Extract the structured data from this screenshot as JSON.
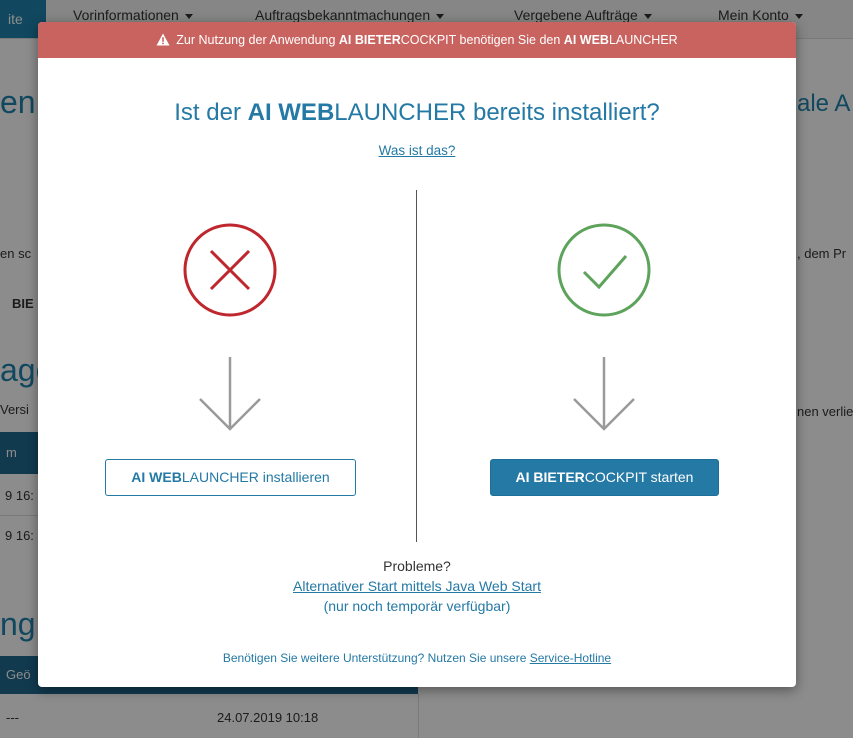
{
  "background": {
    "nav": {
      "home_label": "ite",
      "items": [
        {
          "label": "Vorinformationen"
        },
        {
          "label": "Auftragsbekanntmachungen"
        },
        {
          "label": "Vergebene Aufträge"
        },
        {
          "label": "Mein Konto"
        }
      ]
    },
    "fragments": {
      "heading_left": "en",
      "heading_right": "ale A",
      "text_left_1": "en sc",
      "text_right_1": ", dem Pr",
      "text_left_bold": "BIE",
      "heading_left_2": "age",
      "text_left_2": "Versi",
      "text_right_2": "nen verlie",
      "table_header": "m",
      "row1": "9 16:",
      "row2": "9 16:",
      "heading_left_3": "ng",
      "table_header_2": "Geö",
      "bottom_left": "---",
      "bottom_date": "24.07.2019 10:18"
    }
  },
  "modal": {
    "alert": {
      "icon": "warning-icon",
      "text_prefix": "Zur Nutzung der Anwendung ",
      "app_bold": "AI BIETER",
      "app_rest": "COCKPIT",
      "text_middle": " benötigen Sie den ",
      "launcher_bold": "AI WEB",
      "launcher_rest": "LAUNCHER"
    },
    "title": {
      "prefix": "Ist der ",
      "bold": "AI WEB",
      "rest": "LAUNCHER bereits installiert?"
    },
    "what_is_link": "Was ist das?",
    "left": {
      "status_icon": "cross-circle-icon",
      "arrow_icon": "arrow-down-icon",
      "button_bold": "AI WEB",
      "button_rest": "LAUNCHER installieren"
    },
    "right": {
      "status_icon": "check-circle-icon",
      "arrow_icon": "arrow-down-icon",
      "button_bold": "AI BIETER",
      "button_rest": "COCKPIT starten"
    },
    "problems": {
      "label": "Probleme?",
      "link": "Alternativer Start mittels Java Web Start",
      "note": "(nur noch temporär verfügbar)"
    },
    "footer": {
      "text": "Benötigen Sie weitere Unterstützung? Nutzen Sie unsere ",
      "link": "Service-Hotline"
    }
  },
  "colors": {
    "alert_bg": "#c9635f",
    "accent": "#2479a5",
    "error_red": "#c0262d",
    "success_green": "#5ea35c",
    "arrow_gray": "#9a9a9a"
  }
}
